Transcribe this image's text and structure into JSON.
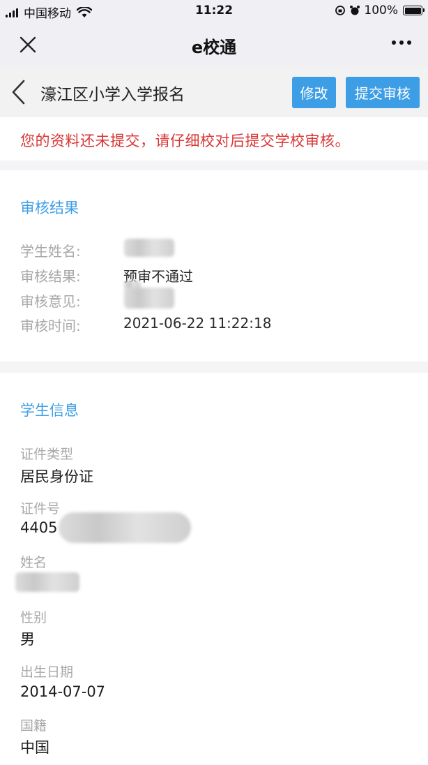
{
  "status_bar": {
    "carrier": "中国移动",
    "time": "11:22",
    "battery": "100%"
  },
  "nav": {
    "title": "e校通"
  },
  "header": {
    "title": "濠江区小学入学报名",
    "edit_label": "修改",
    "submit_label": "提交审核"
  },
  "notice": {
    "text": "您的资料还未提交，请仔细校对后提交学校审核。"
  },
  "review": {
    "section_title": "审核结果",
    "rows": [
      {
        "label": "学生姓名:",
        "value": ""
      },
      {
        "label": "审核结果:",
        "value": "预审不通过"
      },
      {
        "label": "审核意见:",
        "value": ""
      },
      {
        "label": "审核时间:",
        "value": "2021-06-22 11:22:18"
      }
    ]
  },
  "student": {
    "section_title": "学生信息",
    "fields": [
      {
        "label": "证件类型",
        "value": "居民身份证"
      },
      {
        "label": "证件号",
        "value": "4405"
      },
      {
        "label": "姓名",
        "value": ""
      },
      {
        "label": "性别",
        "value": "男"
      },
      {
        "label": "出生日期",
        "value": "2014-07-07"
      },
      {
        "label": "国籍",
        "value": "中国"
      }
    ]
  }
}
